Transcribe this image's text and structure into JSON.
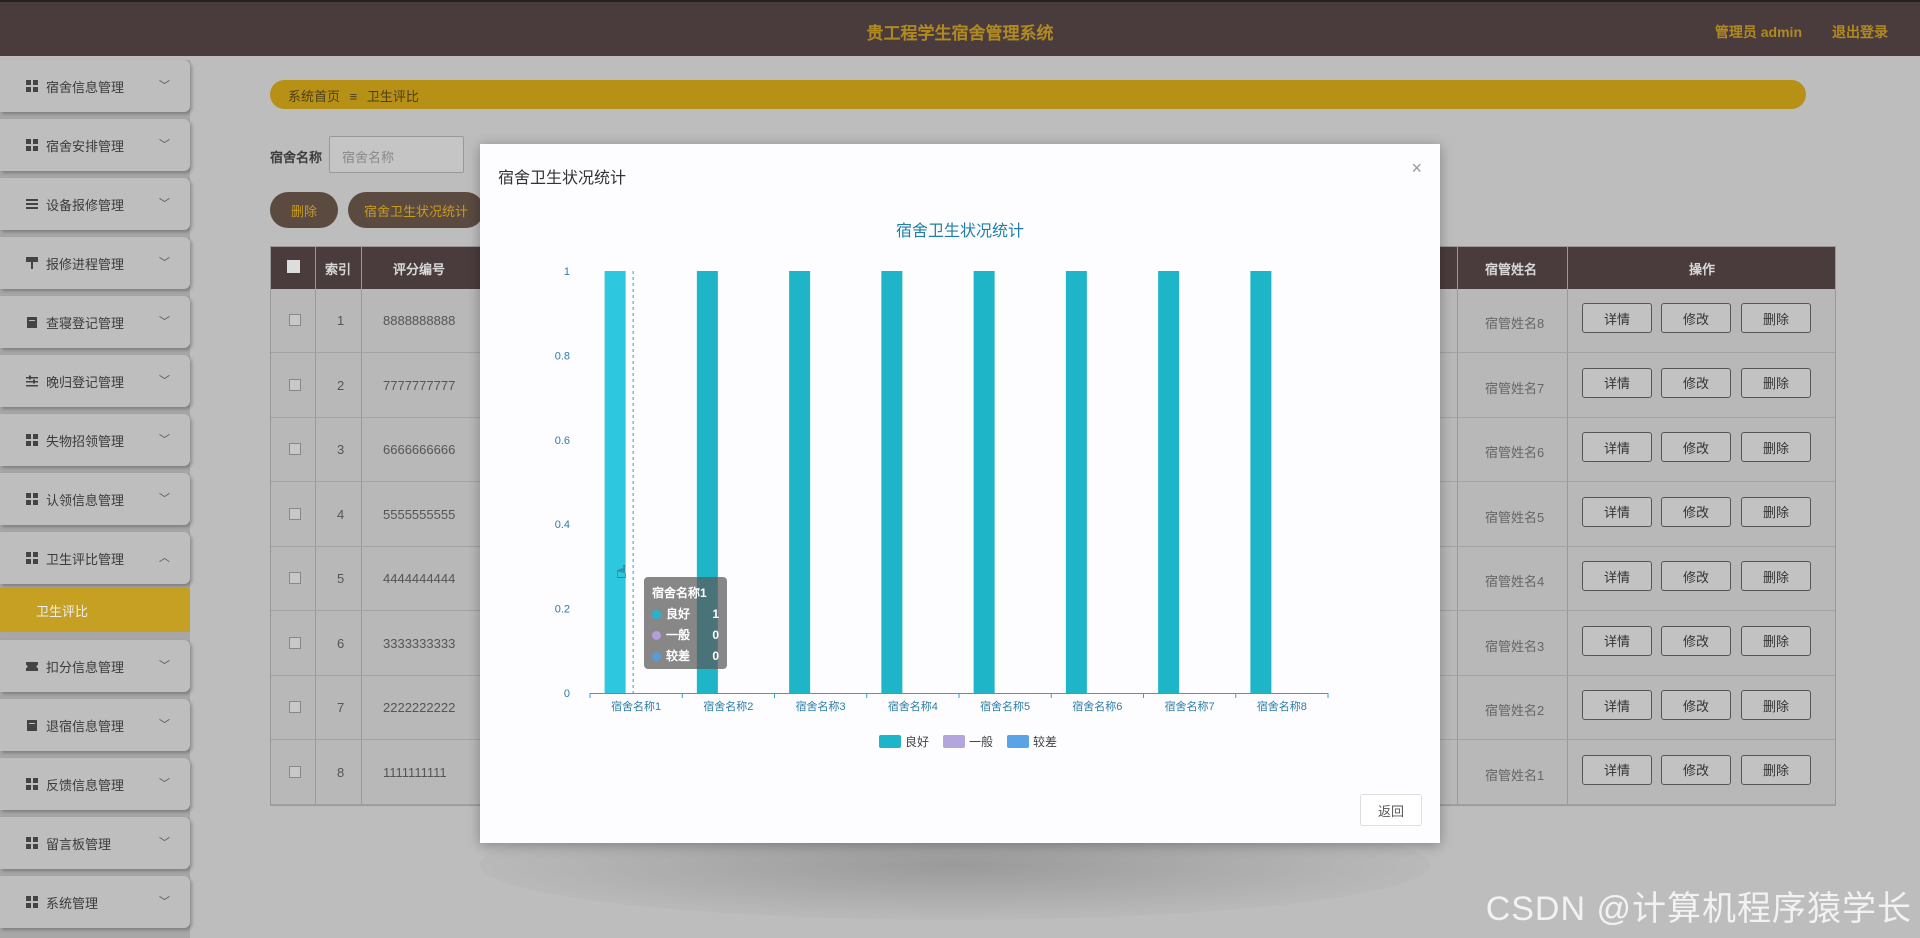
{
  "app": {
    "title": "贵工程学生宿舍管理系统",
    "user": "管理员 admin",
    "logout": "退出登录"
  },
  "sidebar": {
    "items": [
      {
        "label": "宿舍信息管理",
        "icon": "grid-icon"
      },
      {
        "label": "宿舍安排管理",
        "icon": "grid-icon"
      },
      {
        "label": "设备报修管理",
        "icon": "list-icon"
      },
      {
        "label": "报修进程管理",
        "icon": "hammer-icon"
      },
      {
        "label": "查寝登记管理",
        "icon": "clipboard-icon"
      },
      {
        "label": "晚归登记管理",
        "icon": "sliders-icon"
      },
      {
        "label": "失物招领管理",
        "icon": "grid-icon"
      },
      {
        "label": "认领信息管理",
        "icon": "grid-icon"
      },
      {
        "label": "卫生评比管理",
        "icon": "grid-icon"
      },
      {
        "label": "扣分信息管理",
        "icon": "ticket-icon"
      },
      {
        "label": "退宿信息管理",
        "icon": "clipboard-icon"
      },
      {
        "label": "反馈信息管理",
        "icon": "grid-icon"
      },
      {
        "label": "留言板管理",
        "icon": "grid-icon"
      },
      {
        "label": "系统管理",
        "icon": "grid-icon"
      }
    ],
    "active_sub": "卫生评比"
  },
  "breadcrumb": {
    "home": "系统首页",
    "sep": "≡",
    "current": "卫生评比"
  },
  "search": {
    "label": "宿舍名称",
    "placeholder": "宿舍名称"
  },
  "actions": {
    "delete": "删除",
    "stats": "宿舍卫生状况统计"
  },
  "table": {
    "headers": {
      "index": "索引",
      "code": "评分编号",
      "manager": "宿管姓名",
      "ops": "操作"
    },
    "rows": [
      {
        "index": "1",
        "code": "8888888888",
        "manager": "宿管姓名8"
      },
      {
        "index": "2",
        "code": "7777777777",
        "manager": "宿管姓名7"
      },
      {
        "index": "3",
        "code": "6666666666",
        "manager": "宿管姓名6"
      },
      {
        "index": "4",
        "code": "5555555555",
        "manager": "宿管姓名5"
      },
      {
        "index": "5",
        "code": "4444444444",
        "manager": "宿管姓名4"
      },
      {
        "index": "6",
        "code": "3333333333",
        "manager": "宿管姓名3"
      },
      {
        "index": "7",
        "code": "2222222222",
        "manager": "宿管姓名2"
      },
      {
        "index": "8",
        "code": "1111111111",
        "manager": "宿管姓名1"
      }
    ],
    "op_labels": {
      "detail": "详情",
      "edit": "修改",
      "delete": "删除"
    }
  },
  "modal": {
    "title": "宿舍卫生状况统计",
    "close": "×",
    "return": "返回",
    "tooltip": {
      "category": "宿舍名称1",
      "items": [
        {
          "name": "良好",
          "value": "1",
          "color": "#26b3cf"
        },
        {
          "name": "一般",
          "value": "0",
          "color": "#b39ddb"
        },
        {
          "name": "较差",
          "value": "0",
          "color": "#5b9bd5"
        }
      ]
    }
  },
  "chart_data": {
    "type": "bar",
    "title": "宿舍卫生状况统计",
    "categories": [
      "宿舍名称1",
      "宿舍名称2",
      "宿舍名称3",
      "宿舍名称4",
      "宿舍名称5",
      "宿舍名称6",
      "宿舍名称7",
      "宿舍名称8"
    ],
    "series": [
      {
        "name": "良好",
        "values": [
          1,
          1,
          1,
          1,
          1,
          1,
          1,
          1
        ],
        "color": "#1fb5c9"
      },
      {
        "name": "一般",
        "values": [
          0,
          0,
          0,
          0,
          0,
          0,
          0,
          0
        ],
        "color": "#b3a6dd"
      },
      {
        "name": "较差",
        "values": [
          0,
          0,
          0,
          0,
          0,
          0,
          0,
          0
        ],
        "color": "#5aa3e6"
      }
    ],
    "yticks": [
      "0",
      "0.2",
      "0.4",
      "0.6",
      "0.8",
      "1"
    ],
    "ylim": [
      0,
      1
    ],
    "legend": "bottom",
    "grid": false
  },
  "watermark": "CSDN @计算机程序猿学长"
}
